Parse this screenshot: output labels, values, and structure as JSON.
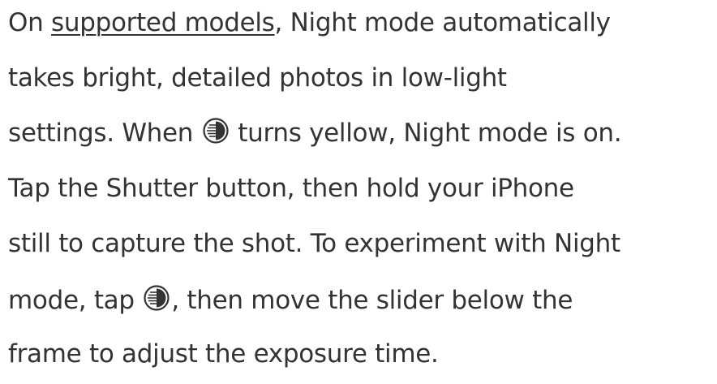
{
  "paragraph": {
    "line1": {
      "before": "On ",
      "link": "supported models",
      "after": ", Night mode automatically"
    },
    "line2": "takes bright, detailed photos in low-light",
    "line3": {
      "before": "settings. When ",
      "after": " turns yellow, Night mode is on."
    },
    "line4": "Tap the Shutter button, then hold your iPhone",
    "line5": "still to capture the shot. To experiment with Night",
    "line6": {
      "before": "mode, tap ",
      "after": ", then move the slider below the"
    },
    "line7": "frame to adjust the exposure time."
  },
  "icons": {
    "night_mode_icon": "night-mode-icon"
  }
}
